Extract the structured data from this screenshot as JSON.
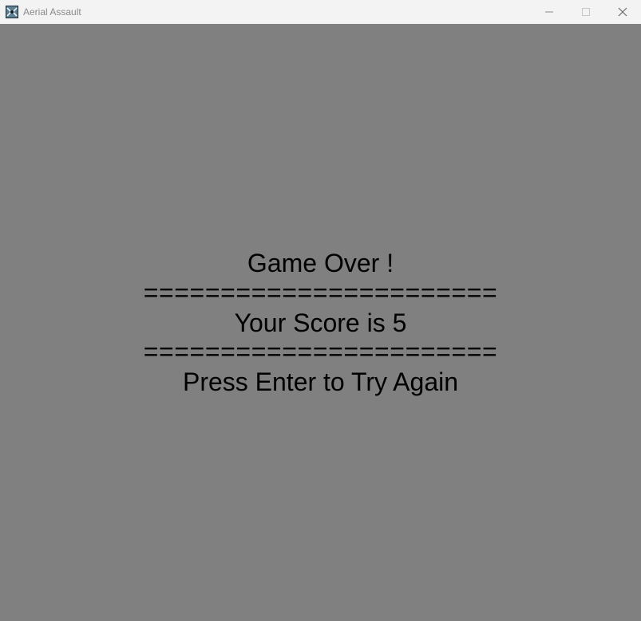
{
  "window": {
    "title": "Aerial Assault",
    "icon": "game-app-icon",
    "controls": {
      "minimize_icon": "minimize-icon",
      "maximize_icon": "maximize-icon",
      "close_icon": "close-icon"
    }
  },
  "game_over_screen": {
    "heading": "Game Over !",
    "divider_top": "=======================",
    "score_text": "Your Score is 5",
    "divider_bottom": "=======================",
    "prompt": "Press Enter to Try Again"
  },
  "colors": {
    "background": "#808080",
    "text": "#000000",
    "titlebar": "#f3f3f3"
  }
}
